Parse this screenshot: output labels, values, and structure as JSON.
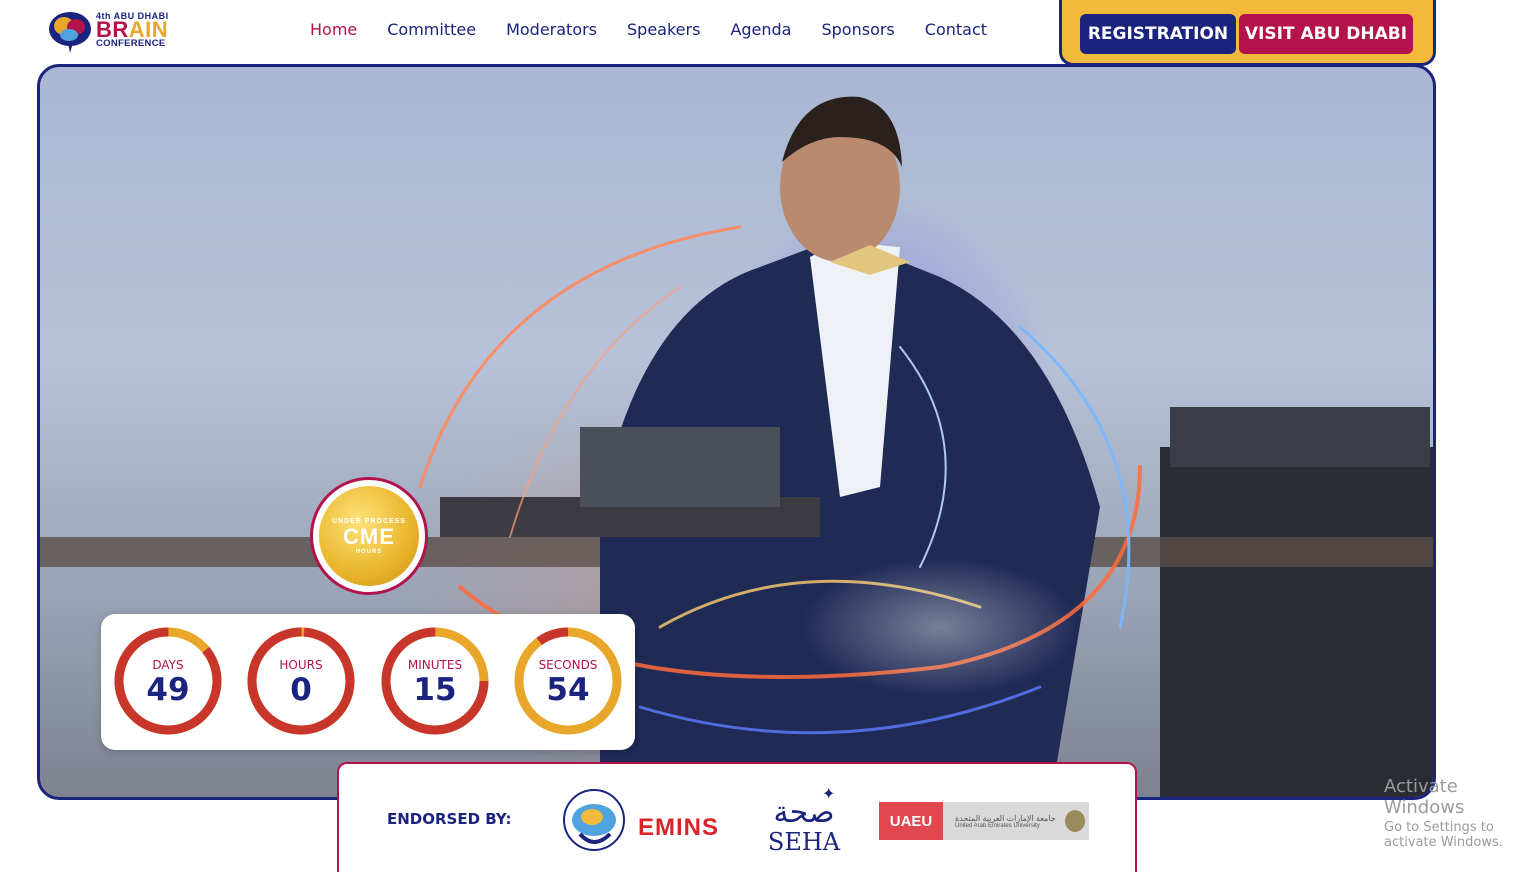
{
  "logo": {
    "edition": "4th ABU DHABI",
    "brain_first": "BR",
    "brain_second": "AIN",
    "conference": "CONFERENCE"
  },
  "nav": {
    "items": [
      "Home",
      "Committee",
      "Moderators",
      "Speakers",
      "Agenda",
      "Sponsors",
      "Contact"
    ],
    "active": "Home"
  },
  "cta": {
    "registration": "REGISTRATION",
    "visit": "VISIT ABU DHABI"
  },
  "cme": {
    "top": "UNDER PROCESS",
    "main": "CME",
    "sub": "HOURS"
  },
  "countdown": {
    "days": {
      "label": "DAYS",
      "value": "49",
      "fraction_remaining": 0.86
    },
    "hours": {
      "label": "HOURS",
      "value": "0",
      "fraction_remaining": 0.99
    },
    "minutes": {
      "label": "MINUTES",
      "value": "15",
      "fraction_remaining": 0.75
    },
    "seconds": {
      "label": "SECONDS",
      "value": "54",
      "fraction_remaining": 0.1
    }
  },
  "endorsed": {
    "label": "ENDORSED BY:",
    "emins": "EMINS",
    "seha_ar": "صحة",
    "seha_en": "SEHA",
    "uaeu_short": "UAEU",
    "uaeu_ar": "جامعة الإمارات العربية المتحدة",
    "uaeu_en": "United Arab Emirates University"
  },
  "system_overlay": {
    "line1": "Activate Windows",
    "line2": "Go to Settings to activate Windows."
  },
  "colors": {
    "navy": "#1a237e",
    "crimson": "#b3124a",
    "gold": "#f2b93a",
    "ring_red": "#c8362b",
    "ring_gold": "#e8a72b"
  }
}
